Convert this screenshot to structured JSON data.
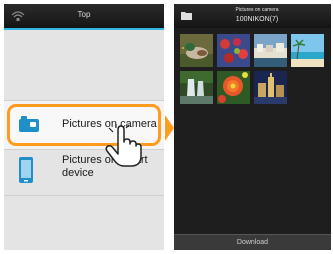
{
  "left_screen": {
    "title": "Top",
    "items": [
      {
        "label": "Pictures on camera",
        "icon": "camera-icon",
        "selected": true
      },
      {
        "label": "Pictures on smart device",
        "icon": "smartphone-icon",
        "selected": false
      }
    ]
  },
  "right_screen": {
    "title": "Pictures on camera",
    "folder": "100NIKON(7)",
    "thumbnails": [
      {
        "name": "mallard-duck-photo"
      },
      {
        "name": "red-flowers-photo"
      },
      {
        "name": "harbor-houses-photo"
      },
      {
        "name": "beach-palms-photo"
      },
      {
        "name": "waterfall-photo"
      },
      {
        "name": "red-flower-closeup-photo"
      },
      {
        "name": "night-city-photo"
      }
    ],
    "download_label": "Download"
  },
  "colors": {
    "accent_blue": "#33b5e5",
    "selection_orange": "#ff9b1f"
  }
}
